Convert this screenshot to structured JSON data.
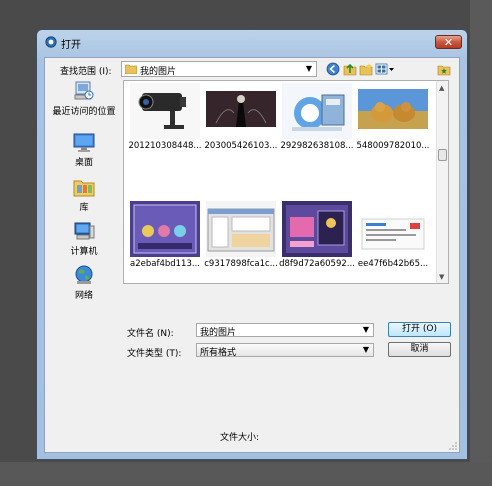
{
  "window": {
    "title": "打开",
    "close_glyph": "✕"
  },
  "lookin": {
    "label": "查找范围 (I):",
    "value": "我的图片"
  },
  "toolbar": {
    "icons": [
      "back-icon",
      "up-folder-icon",
      "new-folder-icon",
      "view-menu-icon"
    ],
    "extra_icon": "folder-star-icon"
  },
  "places": [
    {
      "label": "最近访问的位置",
      "icon": "recent-places-icon"
    },
    {
      "label": "桌面",
      "icon": "desktop-icon"
    },
    {
      "label": "库",
      "icon": "libraries-icon"
    },
    {
      "label": "计算机",
      "icon": "computer-icon"
    },
    {
      "label": "网络",
      "icon": "network-icon"
    }
  ],
  "files": [
    {
      "name": "201210308448...",
      "thumb": "security-camera"
    },
    {
      "name": "203005426103...",
      "thumb": "dark-figure"
    },
    {
      "name": "292982638108...",
      "thumb": "ie-logo-package"
    },
    {
      "name": "548009782010...",
      "thumb": "dogs-sunset"
    },
    {
      "name": "a2ebaf4bd113...",
      "thumb": "game-ui-purple"
    },
    {
      "name": "c9317898fca1c...",
      "thumb": "software-window"
    },
    {
      "name": "d8f9d72a60592...",
      "thumb": "game-ui-pink"
    },
    {
      "name": "ee47f6b42b65...",
      "thumb": "web-page"
    }
  ],
  "filename": {
    "label": "文件名 (N):",
    "value": "我的图片"
  },
  "filetype": {
    "label": "文件类型 (T):",
    "value": "所有格式"
  },
  "buttons": {
    "open": "打开 (O)",
    "cancel": "取消"
  },
  "status": {
    "size_label": "文件大小:"
  },
  "colors": {
    "titlebar": "#a9c4e2",
    "close": "#c75843",
    "selection": "#3c7fb1"
  }
}
